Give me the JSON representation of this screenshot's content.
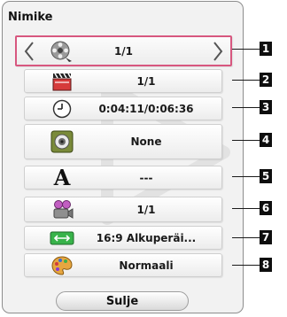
{
  "dialog": {
    "title": "Nimike",
    "close_label": "Sulje"
  },
  "rows": [
    {
      "marker": "1",
      "icon": "film-reel-icon",
      "value": "1/1"
    },
    {
      "marker": "2",
      "icon": "clapperboard-icon",
      "value": "1/1"
    },
    {
      "marker": "3",
      "icon": "clock-icon",
      "value": "0:04:11/0:06:36"
    },
    {
      "marker": "4",
      "icon": "speaker-icon",
      "value": "None"
    },
    {
      "marker": "5",
      "icon": "subtitle-letter-icon",
      "value": "---"
    },
    {
      "marker": "6",
      "icon": "camera-angle-icon",
      "value": "1/1"
    },
    {
      "marker": "7",
      "icon": "aspect-ratio-icon",
      "value": "16:9 Alkuperäi..."
    },
    {
      "marker": "8",
      "icon": "picture-mode-palette-icon",
      "value": "Normaali"
    }
  ],
  "colors": {
    "selection_border": "#d7577f",
    "marker_bg": "#0e0e0e"
  }
}
